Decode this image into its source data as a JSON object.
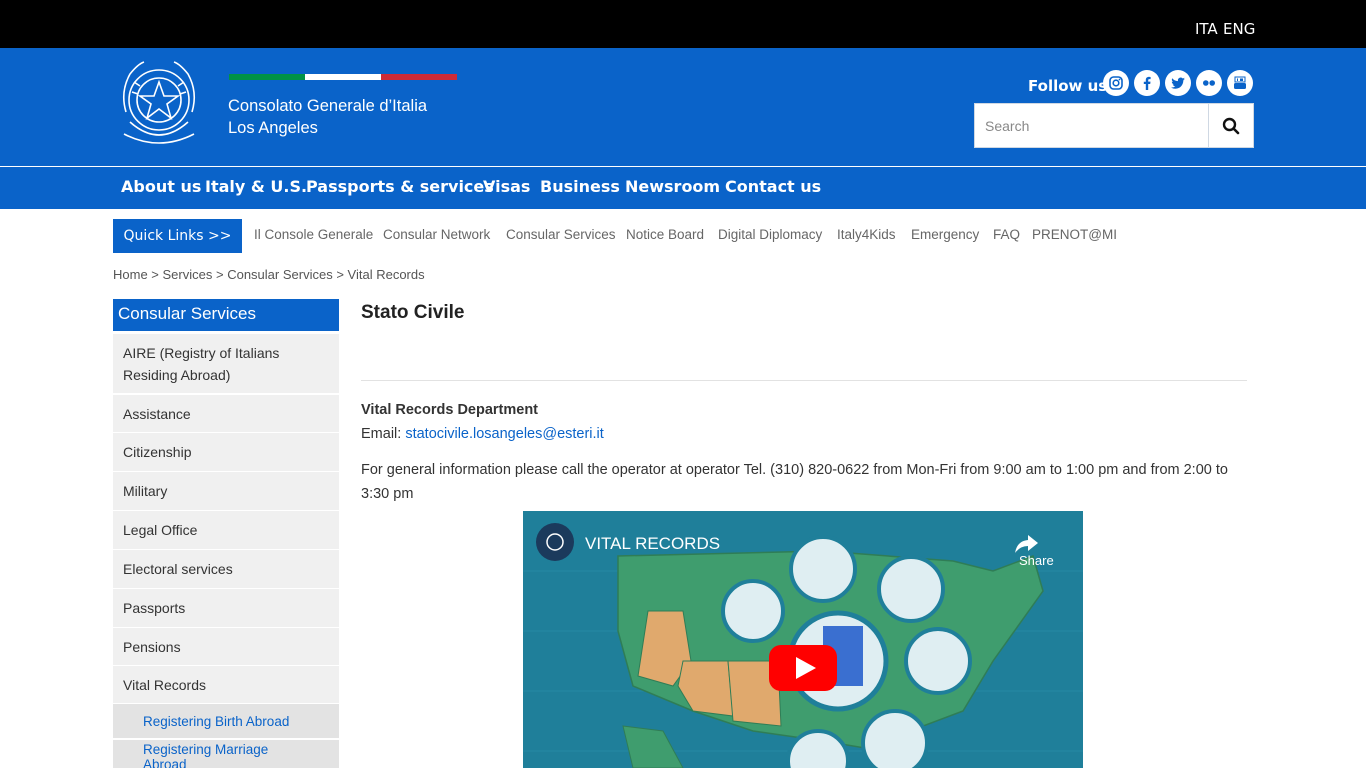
{
  "lang": {
    "ita": "ITA",
    "eng": "ENG"
  },
  "header": {
    "title_line1": "Consolato Generale d’Italia",
    "title_line2": "Los Angeles",
    "follow_label": "Follow us",
    "flag_colors": [
      "#009246",
      "#ffffff",
      "#ce2b37"
    ],
    "social_icons": [
      "instagram-icon",
      "facebook-icon",
      "twitter-icon",
      "flickr-icon",
      "youtube-icon"
    ]
  },
  "search": {
    "placeholder": "Search"
  },
  "nav": {
    "items": [
      "About us",
      "Italy & U.S.",
      "Passports & services",
      "Visas",
      "Business",
      "Newsroom",
      "Contact us"
    ]
  },
  "quick": {
    "button": "Quick Links >>",
    "links": [
      "Il Console Generale",
      "Consular Network",
      "Consular Services",
      "Notice Board",
      "Digital Diplomacy",
      "Italy4Kids",
      "Emergency",
      "FAQ",
      "PRENOT@MI"
    ]
  },
  "breadcrumb": {
    "home": "Home",
    "services": "Services",
    "consular": "Consular Services",
    "current": "Vital Records",
    "sep": " > "
  },
  "sidebar": {
    "title": "Consular Services",
    "items": [
      "AIRE (Registry of Italians Residing Abroad)",
      "Assistance",
      "Citizenship",
      "Military",
      "Legal Office",
      "Electoral services",
      "Passports",
      "Pensions",
      "Vital Records"
    ],
    "subitems": [
      "Registering Birth Abroad",
      "Registering Marriage Abroad"
    ]
  },
  "content": {
    "title": "Stato Civile",
    "dept": "Vital Records Department",
    "email_label": "Email: ",
    "email": "statocivile.losangeles@esteri.it",
    "info": "For general information please call the operator at operator Tel. (310) 820-0622 from Mon-Fri from 9:00 am to 1:00 pm and from 2:00 to 3:30 pm"
  },
  "video": {
    "title": "VITAL RECORDS",
    "share": "Share",
    "colors": {
      "sea": "#1f7f9a",
      "land": "#3f9d6e",
      "highlight": "#e0a96d",
      "play": "#ff0000"
    }
  },
  "colors": {
    "brand_blue": "#0a63c9",
    "topbar": "#000000"
  }
}
